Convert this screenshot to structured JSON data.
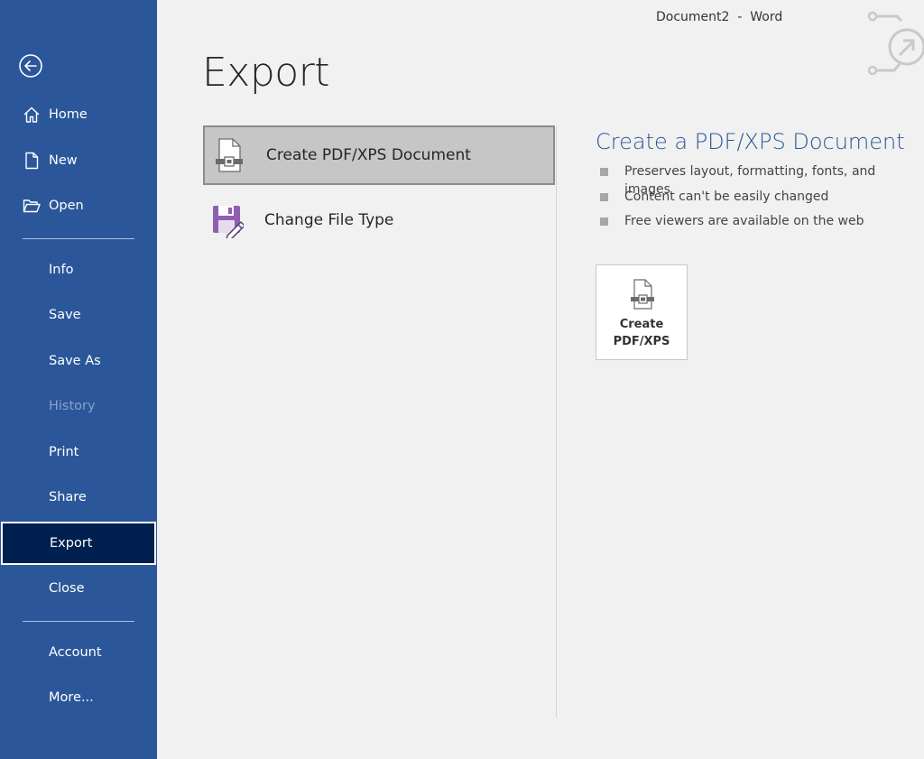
{
  "window": {
    "title": "Document2  -  Word"
  },
  "sidebar": {
    "back_icon": "back-arrow-icon",
    "items": [
      {
        "label": "Home",
        "icon": "home-icon"
      },
      {
        "label": "New",
        "icon": "new-document-icon"
      },
      {
        "label": "Open",
        "icon": "open-folder-icon"
      },
      {
        "label": "Info"
      },
      {
        "label": "Save"
      },
      {
        "label": "Save As"
      },
      {
        "label": "History",
        "state": "disabled"
      },
      {
        "label": "Print"
      },
      {
        "label": "Share"
      },
      {
        "label": "Export",
        "state": "selected"
      },
      {
        "label": "Close"
      },
      {
        "label": "Account"
      },
      {
        "label": "More..."
      }
    ]
  },
  "page": {
    "title": "Export",
    "options": [
      {
        "label": "Create PDF/XPS Document",
        "icon": "pdf-document-icon",
        "state": "selected"
      },
      {
        "label": "Change File Type",
        "icon": "save-as-type-icon"
      }
    ]
  },
  "detail": {
    "title": "Create a PDF/XPS Document",
    "bullets": [
      "Preserves layout, formatting, fonts, and images",
      "Content can't be easily changed",
      "Free viewers are available on the web"
    ],
    "button_line1": "Create",
    "button_line2": "PDF/XPS"
  },
  "colors": {
    "sidebar_bg": "#2b579a",
    "sidebar_selected": "#002050",
    "accent_title": "#2b579a",
    "change_type_icon": "#8e5fb2"
  }
}
